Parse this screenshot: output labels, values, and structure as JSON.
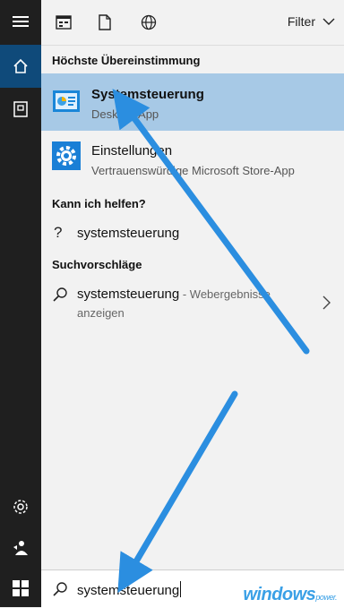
{
  "topbar": {
    "filter_label": "Filter"
  },
  "sections": {
    "best_match": "Höchste Übereinstimmung",
    "help": "Kann ich helfen?",
    "suggestions": "Suchvorschläge"
  },
  "best_result": {
    "title": "Systemsteuerung",
    "subtitle": "Desktop-App"
  },
  "second_result": {
    "title": "Einstellungen",
    "subtitle": "Vertrauenswürdige Microsoft Store-App"
  },
  "help_item": {
    "label": "systemsteuerung"
  },
  "suggestion": {
    "query": "systemsteuerung",
    "suffix": " - Webergebnisse",
    "line2": "anzeigen"
  },
  "search": {
    "value": "systemsteuerung"
  },
  "watermark": {
    "main": "windows",
    "small": "power."
  },
  "colors": {
    "rail": "#1f1f1f",
    "rail_active": "#0f4a7a",
    "highlight": "#a7c9e6",
    "arrow": "#2b8ee0"
  }
}
